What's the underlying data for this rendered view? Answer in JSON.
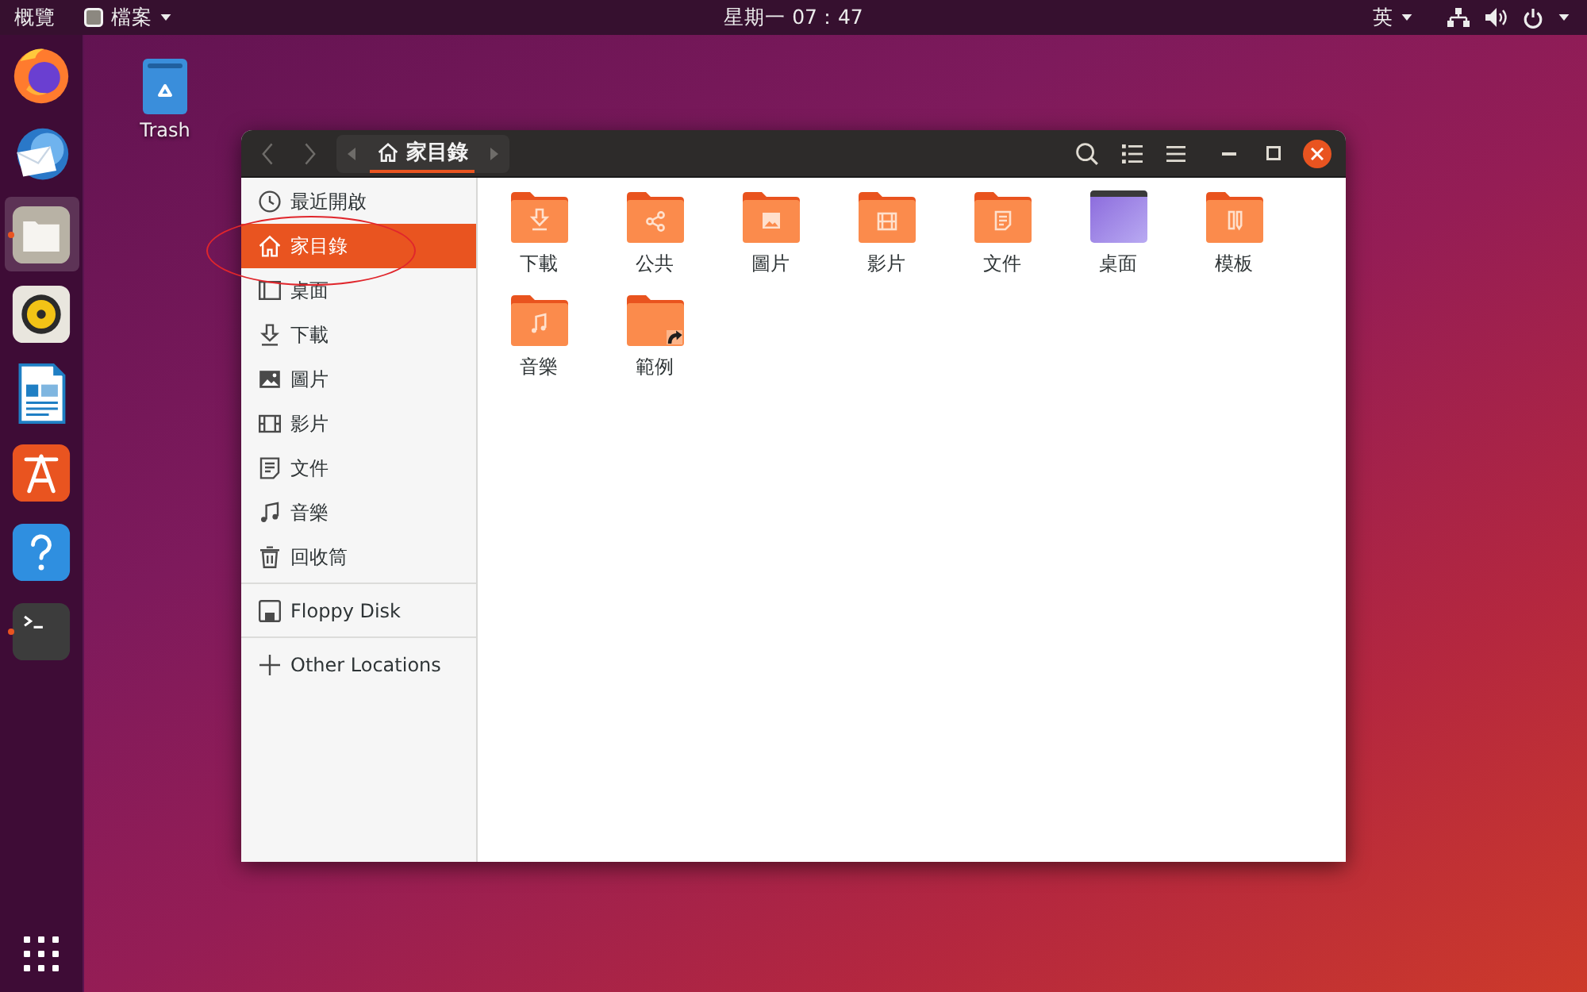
{
  "top_bar": {
    "activities": "概覽",
    "app_menu": {
      "label": "檔案"
    },
    "clock": "星期一 07：47",
    "input_method": "英",
    "status_icons": [
      {
        "kind": "network"
      },
      {
        "kind": "volume"
      },
      {
        "kind": "power"
      }
    ]
  },
  "dock": {
    "items": [
      {
        "kind": "browser",
        "running": false,
        "focused": false
      },
      {
        "kind": "mail",
        "running": false,
        "focused": false
      },
      {
        "kind": "files",
        "running": true,
        "focused": true
      },
      {
        "kind": "music-player",
        "running": false,
        "focused": false
      },
      {
        "kind": "word-processor",
        "running": false,
        "focused": false
      },
      {
        "kind": "software",
        "running": false,
        "focused": false
      },
      {
        "kind": "help",
        "running": false,
        "focused": false
      },
      {
        "kind": "terminal",
        "running": true,
        "focused": false
      }
    ]
  },
  "desktop": {
    "icons": [
      {
        "label": "Trash",
        "kind": "trash"
      }
    ]
  },
  "window": {
    "nav": [
      {
        "kind": "back",
        "disabled": true
      },
      {
        "kind": "forward",
        "disabled": true
      }
    ],
    "path": [
      {
        "label": "家目錄",
        "kind": "home",
        "selected": true
      }
    ],
    "toolbar": [
      {
        "kind": "search"
      },
      {
        "kind": "view-list"
      },
      {
        "kind": "menu"
      }
    ],
    "controls": [
      {
        "kind": "minimize"
      },
      {
        "kind": "maximize"
      },
      {
        "kind": "close"
      }
    ],
    "sidebar": {
      "sections": [
        {
          "items": [
            {
              "label": "最近開啟",
              "kind": "recent",
              "selected": false
            },
            {
              "label": "家目錄",
              "kind": "home",
              "selected": true
            },
            {
              "label": "桌面",
              "kind": "desktop",
              "selected": false
            },
            {
              "label": "下載",
              "kind": "download",
              "selected": false
            },
            {
              "label": "圖片",
              "kind": "pictures",
              "selected": false
            },
            {
              "label": "影片",
              "kind": "videos",
              "selected": false
            },
            {
              "label": "文件",
              "kind": "documents",
              "selected": false
            },
            {
              "label": "音樂",
              "kind": "music",
              "selected": false
            },
            {
              "label": "回收筒",
              "kind": "trash",
              "selected": false
            }
          ]
        },
        {
          "items": [
            {
              "label": "Floppy Disk",
              "kind": "floppy",
              "selected": false
            }
          ]
        },
        {
          "items": [
            {
              "label": "Other Locations",
              "kind": "other",
              "selected": false
            }
          ]
        }
      ]
    },
    "files": [
      {
        "label": "下載",
        "kind": "download"
      },
      {
        "label": "公共",
        "kind": "share"
      },
      {
        "label": "圖片",
        "kind": "pictures"
      },
      {
        "label": "影片",
        "kind": "videos"
      },
      {
        "label": "文件",
        "kind": "documents"
      },
      {
        "label": "桌面",
        "kind": "desktop"
      },
      {
        "label": "模板",
        "kind": "templates"
      },
      {
        "label": "音樂",
        "kind": "music"
      },
      {
        "label": "範例",
        "kind": "link"
      }
    ]
  },
  "annotations": [
    {
      "kind": "ellipse"
    }
  ]
}
